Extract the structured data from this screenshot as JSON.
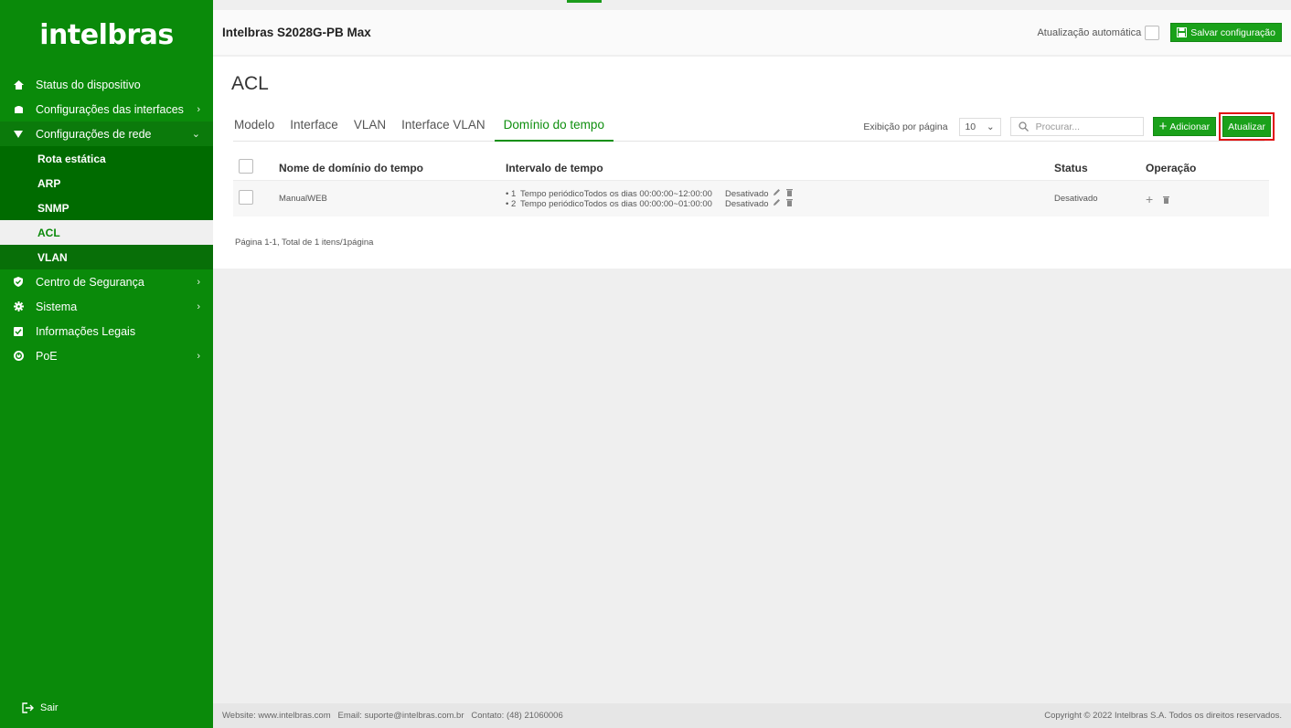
{
  "brand": {
    "logo": "intelbras"
  },
  "header": {
    "device_name": "Intelbras S2028G-PB Max",
    "auto_update_label": "Atualização automática",
    "save_label": "Salvar configuração"
  },
  "sidebar": {
    "items": [
      {
        "label": "Status do dispositivo",
        "icon": "home-icon"
      },
      {
        "label": "Configurações das interfaces",
        "icon": "interface-icon"
      },
      {
        "label": "Configurações de rede",
        "icon": "network-icon"
      },
      {
        "label": "Centro de Segurança",
        "icon": "shield-icon"
      },
      {
        "label": "Sistema",
        "icon": "gear-icon"
      },
      {
        "label": "Informações Legais",
        "icon": "check-square-icon"
      },
      {
        "label": "PoE",
        "icon": "power-icon"
      }
    ],
    "sub_items": [
      "Rota estática",
      "ARP",
      "SNMP",
      "ACL",
      "VLAN"
    ],
    "logout_label": "Sair"
  },
  "main": {
    "title": "ACL",
    "tabs": [
      "Modelo",
      "Interface",
      "VLAN",
      "Interface VLAN",
      "Domínio do tempo"
    ],
    "per_page_label": "Exibição por página",
    "per_page_value": "10",
    "search_placeholder": "Procurar...",
    "add_label": "Adicionar",
    "refresh_label": "Atualizar",
    "table": {
      "columns": [
        "Nome de domínio do tempo",
        "Intervalo de tempo",
        "Status",
        "Operação"
      ],
      "rows": [
        {
          "name": "ManualWEB",
          "intervals": [
            {
              "num": "1",
              "desc": "Tempo periódicoTodos os dias 00:00:00~12:00:00",
              "status": "Desativado"
            },
            {
              "num": "2",
              "desc": "Tempo periódicoTodos os dias 00:00:00~01:00:00",
              "status": "Desativado"
            }
          ],
          "status": "Desativado"
        }
      ]
    },
    "pagination": "Página 1-1, Total de 1 itens/1página"
  },
  "footer": {
    "left": "Website: www.intelbras.com   Email: suporte@intelbras.com.br   Contato: (48) 21060006",
    "right": "Copyright © 2022 Intelbras S.A. Todos os direitos reservados."
  },
  "colors": {
    "brand_green": "#0a8a0a",
    "button_green": "#1aa11a",
    "highlight_red": "#e01010"
  }
}
